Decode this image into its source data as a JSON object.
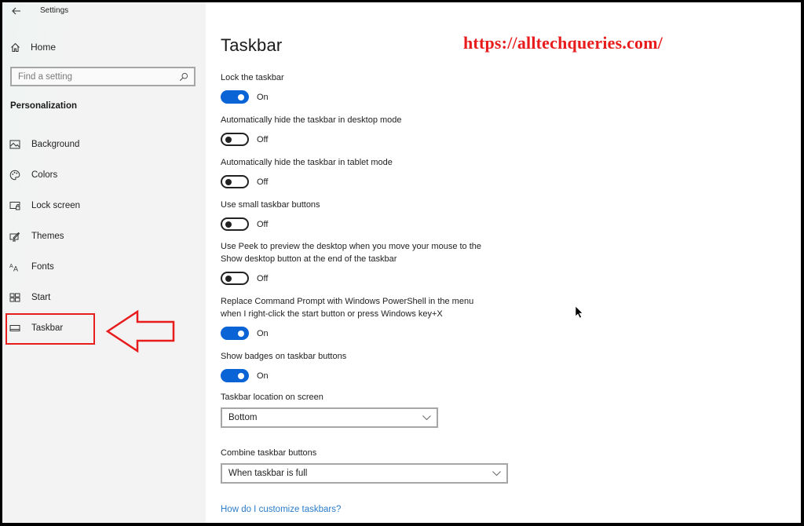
{
  "window": {
    "app_title": "Settings",
    "back_icon": "arrow-left-icon"
  },
  "sidebar": {
    "home": {
      "label": "Home",
      "icon": "home-icon"
    },
    "search": {
      "placeholder": "Find a setting",
      "value": "",
      "icon": "search-icon"
    },
    "section_heading": "Personalization",
    "items": [
      {
        "label": "Background",
        "icon": "picture-icon",
        "selected": false
      },
      {
        "label": "Colors",
        "icon": "palette-icon",
        "selected": false
      },
      {
        "label": "Lock screen",
        "icon": "lock-screen-icon",
        "selected": false
      },
      {
        "label": "Themes",
        "icon": "themes-icon",
        "selected": false
      },
      {
        "label": "Fonts",
        "icon": "fonts-icon",
        "selected": false
      },
      {
        "label": "Start",
        "icon": "start-icon",
        "selected": false
      },
      {
        "label": "Taskbar",
        "icon": "taskbar-icon",
        "selected": true
      }
    ]
  },
  "annotation": {
    "highlight_color": "#e81c1c",
    "arrow_points_to": "Taskbar",
    "watermark_text": "https://alltechqueries.com/"
  },
  "main": {
    "title": "Taskbar",
    "toggles": [
      {
        "label": "Lock the taskbar",
        "state": "On",
        "on": true
      },
      {
        "label": "Automatically hide the taskbar in desktop mode",
        "state": "Off",
        "on": false
      },
      {
        "label": "Automatically hide the taskbar in tablet mode",
        "state": "Off",
        "on": false
      },
      {
        "label": "Use small taskbar buttons",
        "state": "Off",
        "on": false
      },
      {
        "label": "Use Peek to preview the desktop when you move your mouse to the Show desktop button at the end of the taskbar",
        "label_lines": [
          "Use Peek to preview the desktop when you move your mouse to the",
          "Show desktop button at the end of the taskbar"
        ],
        "state": "Off",
        "on": false
      },
      {
        "label": "Replace Command Prompt with Windows PowerShell in the menu when I right-click the start button or press Windows key+X",
        "label_lines": [
          "Replace Command Prompt with Windows PowerShell in the menu",
          "when I right-click the start button or press Windows key+X"
        ],
        "state": "On",
        "on": true
      },
      {
        "label": "Show badges on taskbar buttons",
        "state": "On",
        "on": true
      }
    ],
    "selects": [
      {
        "label": "Taskbar location on screen",
        "value": "Bottom"
      },
      {
        "label": "Combine taskbar buttons",
        "value": "When taskbar is full"
      }
    ],
    "help_link": "How do I customize taskbars?"
  },
  "colors": {
    "accent": "#0a64d6",
    "link": "#2b7cc9",
    "annotation_red": "#e81c1c",
    "sidebar_bg": "#f3f3f3"
  }
}
